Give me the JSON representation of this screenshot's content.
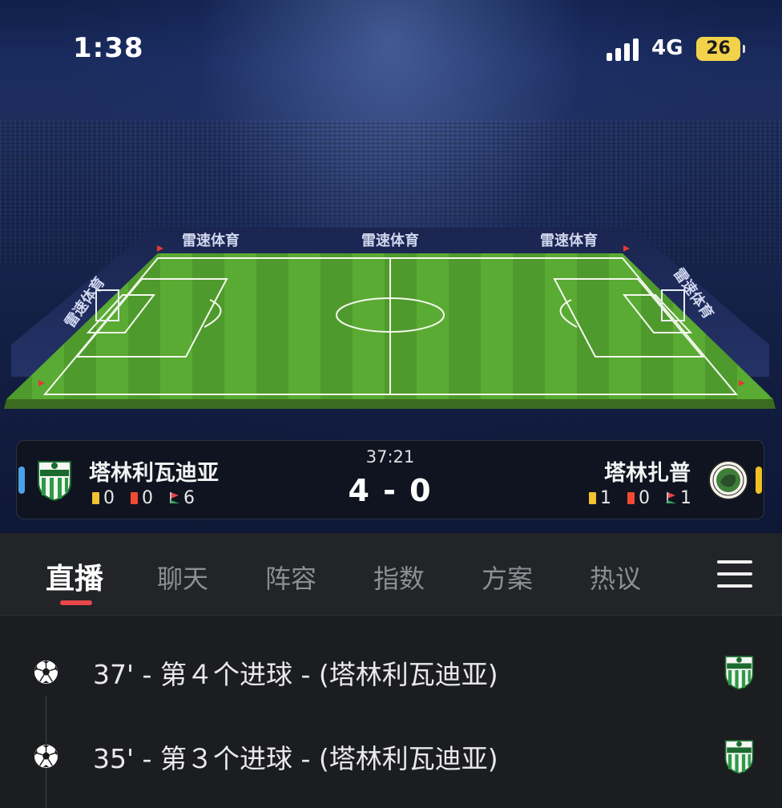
{
  "status_bar": {
    "time": "1:38",
    "network": "4G",
    "battery": "26",
    "battery_color": "#f2d24b"
  },
  "stadium": {
    "board_text": "雷速体育"
  },
  "match": {
    "time": "37:21",
    "score": "4 - 0",
    "home": {
      "name": "塔林利瓦迪亚",
      "yellow_cards": "0",
      "red_cards": "0",
      "corners": "6",
      "badge": "levadia-crest-icon",
      "side_color": "#4aa3ea"
    },
    "away": {
      "name": "塔林扎普",
      "yellow_cards": "1",
      "red_cards": "0",
      "corners": "1",
      "badge": "zapoos-crest-icon",
      "side_color": "#f2c024"
    }
  },
  "tabs": [
    {
      "label": "直播",
      "active": true
    },
    {
      "label": "聊天"
    },
    {
      "label": "阵容"
    },
    {
      "label": "指数"
    },
    {
      "label": "方案"
    },
    {
      "label": "热议"
    }
  ],
  "tab_accent": "#e8474a",
  "events": [
    {
      "text": "37' - 第４个进球 - (塔林利瓦迪亚)",
      "icon": "soccer-ball-icon",
      "team_badge": "levadia-crest-icon"
    },
    {
      "text": "35' - 第３个进球 - (塔林利瓦迪亚)",
      "icon": "soccer-ball-icon",
      "team_badge": "levadia-crest-icon"
    }
  ]
}
